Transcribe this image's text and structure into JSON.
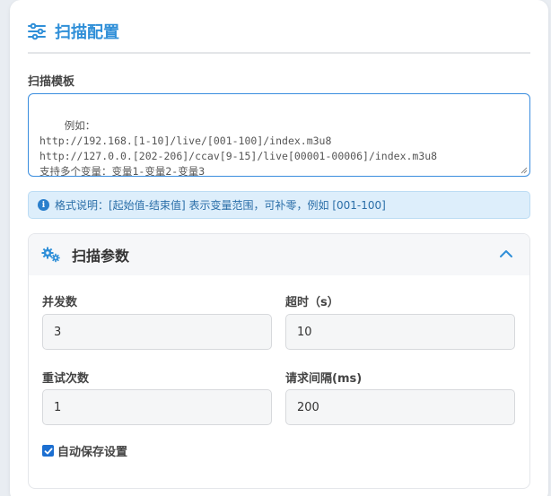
{
  "header": {
    "title": "扫描配置",
    "icon": "sliders-icon",
    "accent_color": "#2f8fd8"
  },
  "template": {
    "label": "扫描模板",
    "value": "例如：\nhttp://192.168.[1-10]/live/[001-100]/index.m3u8\nhttp://127.0.0.[202-206]/ccav[9-15]/live[00001-00006]/index.m3u8\n支持多个变量：变量1-变量2-变量3"
  },
  "info": {
    "icon": "info-icon",
    "text": "格式说明：[起始值-结束值] 表示变量范围，可补零，例如 [001-100]"
  },
  "params": {
    "title": "扫描参数",
    "icon": "gears-icon",
    "collapse_icon": "chevron-up-icon",
    "fields": [
      {
        "label": "并发数",
        "value": "3"
      },
      {
        "label": "超时（s）",
        "value": "10"
      },
      {
        "label": "重试次数",
        "value": "1"
      },
      {
        "label": "请求间隔(ms)",
        "value": "200"
      }
    ],
    "autosave": {
      "label": "自动保存设置",
      "checked": true
    }
  }
}
